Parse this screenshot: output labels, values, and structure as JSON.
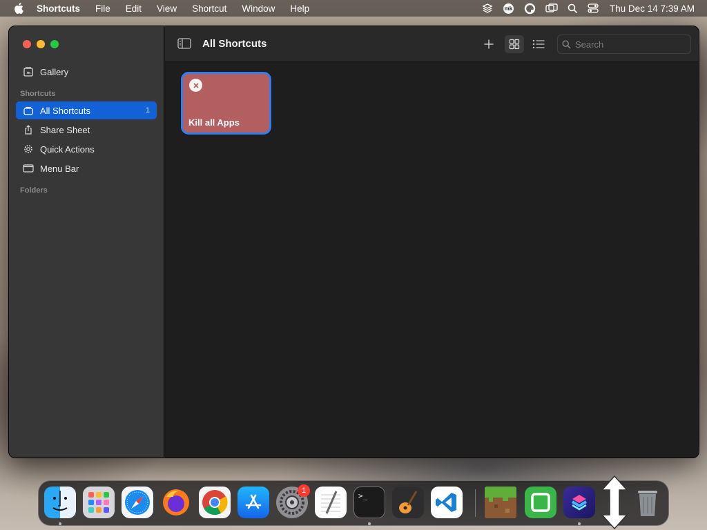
{
  "menubar": {
    "app_name": "Shortcuts",
    "menus": [
      "File",
      "Edit",
      "View",
      "Shortcut",
      "Window",
      "Help"
    ],
    "status_icons": [
      "layers-icon",
      "mk-icon",
      "qr-icon",
      "screen-mirror-icon",
      "search-icon",
      "control-center-icon"
    ],
    "mk_label": "mk",
    "clock": "Thu Dec 14  7:39 AM"
  },
  "sidebar": {
    "gallery": "Gallery",
    "shortcuts_section": "Shortcuts",
    "items": [
      {
        "label": "All Shortcuts",
        "count": "1",
        "icon": "stack-icon",
        "active": true
      },
      {
        "label": "Share Sheet",
        "icon": "share-icon"
      },
      {
        "label": "Quick Actions",
        "icon": "gear-icon"
      },
      {
        "label": "Menu Bar",
        "icon": "menubar-icon"
      }
    ],
    "folders_section": "Folders"
  },
  "toolbar": {
    "title": "All Shortcuts",
    "search_placeholder": "Search"
  },
  "shortcuts": [
    {
      "label": "Kill all Apps",
      "color": "#b45f5f"
    }
  ],
  "dock": {
    "apps": [
      "Finder",
      "Launchpad",
      "Safari",
      "Firefox",
      "Chrome",
      "App Store",
      "System Settings",
      "TextEdit",
      "Terminal",
      "GarageBand",
      "VS Code",
      "Minecraft",
      "Camtasia",
      "Shortcuts",
      "Trash"
    ],
    "system_settings_badge": "1",
    "terminal_prompt": ">_"
  },
  "colors": {
    "accent": "#1361d6",
    "card": "#b45f5f",
    "card_border": "#2f7ff0"
  }
}
